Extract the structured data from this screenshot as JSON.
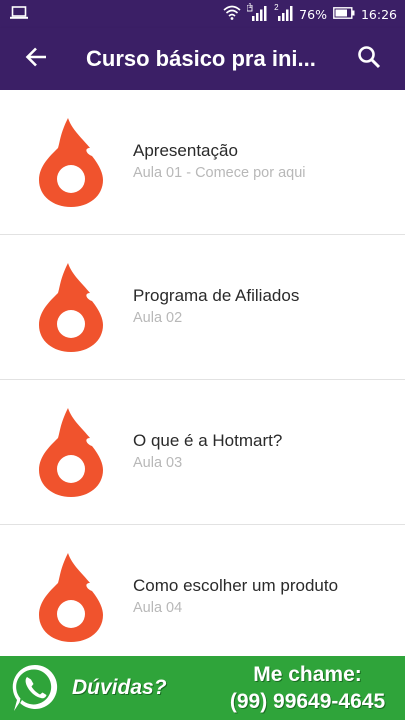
{
  "status_bar": {
    "battery": "76%",
    "time": "16:26",
    "sim1": "1",
    "sim2": "2",
    "icons": [
      "laptop-icon",
      "wifi-icon",
      "signal-icon",
      "signal-icon",
      "battery-icon"
    ]
  },
  "app_bar": {
    "title": "Curso básico pra ini...",
    "back_icon": "arrow-left-icon",
    "search_icon": "search-icon",
    "color": "#3b1f66"
  },
  "lessons": [
    {
      "title": "Apresentação",
      "subtitle": "Aula 01 - Comece por aqui",
      "icon": "hotmart-flame-icon"
    },
    {
      "title": "Programa de Afiliados",
      "subtitle": "Aula 02",
      "icon": "hotmart-flame-icon"
    },
    {
      "title": "O que é a Hotmart?",
      "subtitle": "Aula 03",
      "icon": "hotmart-flame-icon"
    },
    {
      "title": "Como escolher um produto",
      "subtitle": "Aula 04",
      "icon": "hotmart-flame-icon"
    }
  ],
  "promo": {
    "doubt_label": "Dúvidas?",
    "call_label": "Me chame:",
    "phone": "(99) 99649-4645",
    "icon": "whatsapp-icon",
    "color": "#2fa43a"
  },
  "colors": {
    "flame": "#f0532d",
    "title_text": "#2a2a2a",
    "subtitle_text": "#b8b8b8"
  }
}
